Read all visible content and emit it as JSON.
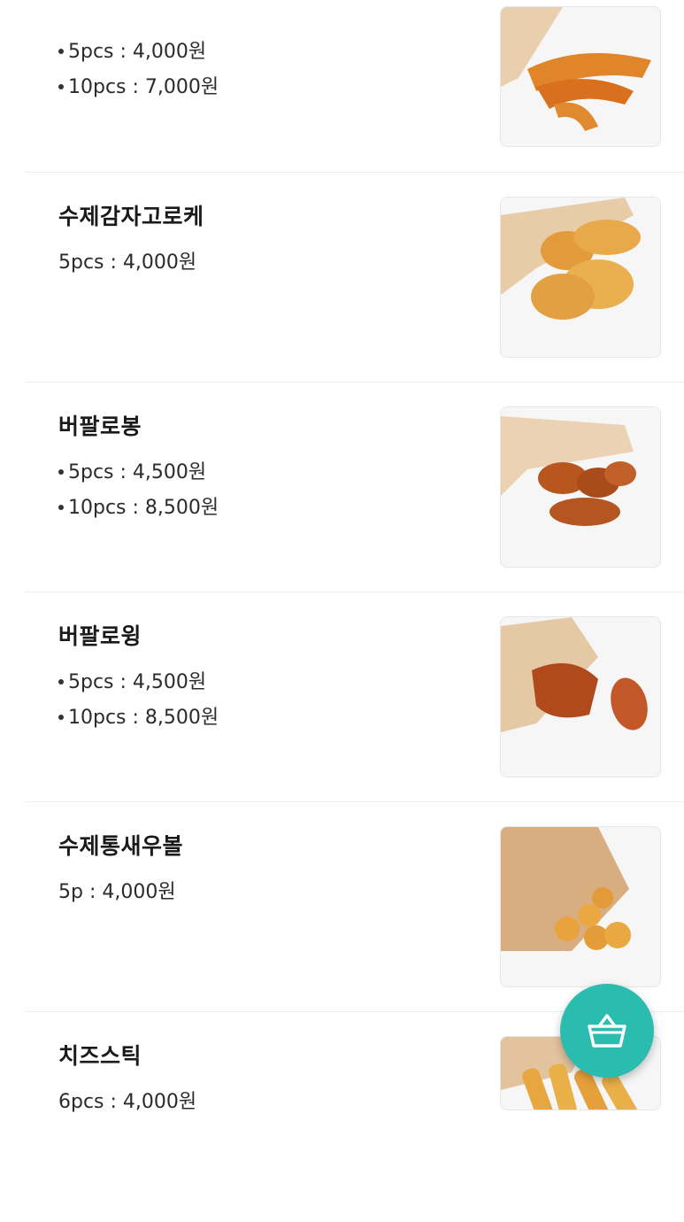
{
  "menu": {
    "items": [
      {
        "name": "",
        "prices": [
          "5pcs : 4,000원",
          "10pcs : 7,000원"
        ],
        "bulleted": true,
        "image": "fried-shrimp-in-paper-bag"
      },
      {
        "name": "수제감자고로케",
        "prices": [
          "5pcs : 4,000원"
        ],
        "bulleted": false,
        "image": "potato-croquettes-in-paper-bag"
      },
      {
        "name": "버팔로봉",
        "prices": [
          "5pcs : 4,500원",
          "10pcs : 8,500원"
        ],
        "bulleted": true,
        "image": "buffalo-drumettes-in-paper-bag"
      },
      {
        "name": "버팔로윙",
        "prices": [
          "5pcs : 4,500원",
          "10pcs : 8,500원"
        ],
        "bulleted": true,
        "image": "buffalo-wings-in-paper-bag"
      },
      {
        "name": "수제통새우볼",
        "prices": [
          "5p : 4,000원"
        ],
        "bulleted": false,
        "image": "shrimp-balls-in-paper-bag"
      },
      {
        "name": "치즈스틱",
        "prices": [
          "6pcs : 4,000원"
        ],
        "bulleted": false,
        "image": "cheese-sticks-in-paper-bag"
      }
    ]
  },
  "fab": {
    "icon": "basket-icon",
    "color": "#2bbcb0"
  }
}
